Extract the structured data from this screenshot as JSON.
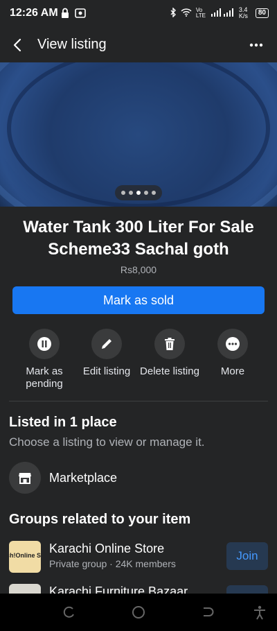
{
  "status_bar": {
    "time": "12:26 AM",
    "network_speed": "3.4 K/s",
    "battery": "80",
    "lte": "Vo LTE"
  },
  "app_bar": {
    "title": "View listing"
  },
  "hero": {
    "image_count": 5,
    "active_index": 2
  },
  "listing": {
    "title": "Water Tank 300 Liter For Sale Scheme33 Sachal goth",
    "price": "Rs8,000",
    "primary_action": "Mark as sold"
  },
  "actions": [
    {
      "label": "Mark as pending",
      "icon": "pause-icon"
    },
    {
      "label": "Edit listing",
      "icon": "pencil-icon"
    },
    {
      "label": "Delete listing",
      "icon": "trash-icon"
    },
    {
      "label": "More",
      "icon": "more-icon"
    }
  ],
  "listed_in": {
    "title": "Listed in 1 place",
    "subtitle": "Choose a listing to view or manage it.",
    "marketplace_label": "Marketplace"
  },
  "groups": {
    "title": "Groups related to your item",
    "items": [
      {
        "name": "Karachi Online Store",
        "meta": "Private group · 24K members",
        "join": "Join",
        "thumb_text": "ch!Online S"
      },
      {
        "name": "Karachi Furniture Bazaar",
        "meta": "",
        "join": "Join",
        "thumb_text": ""
      }
    ]
  },
  "colors": {
    "background": "#242526",
    "primary": "#1877f2",
    "secondary_text": "#b0b3b8"
  }
}
